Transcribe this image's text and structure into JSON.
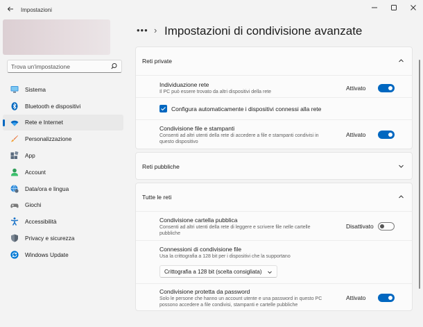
{
  "window": {
    "title": "Impostazioni",
    "minimize": "—",
    "maximize": "☐",
    "close": "✕"
  },
  "search": {
    "placeholder": "Trova un'impostazione"
  },
  "sidebar": {
    "items": [
      {
        "label": "Sistema",
        "icon": "monitor-icon",
        "color": "#0078d4"
      },
      {
        "label": "Bluetooth e dispositivi",
        "icon": "bluetooth-icon",
        "color": "#0067c0"
      },
      {
        "label": "Rete e Internet",
        "icon": "wifi-icon",
        "color": "#0067c0",
        "selected": true
      },
      {
        "label": "Personalizzazione",
        "icon": "brush-icon",
        "color": "#e8733a"
      },
      {
        "label": "App",
        "icon": "apps-icon",
        "color": "#5a6b7e"
      },
      {
        "label": "Account",
        "icon": "person-icon",
        "color": "#2f9e58"
      },
      {
        "label": "Data/ora e lingua",
        "icon": "globe-clock-icon",
        "color": "#0078d4"
      },
      {
        "label": "Giochi",
        "icon": "gamepad-icon",
        "color": "#6b6b6b"
      },
      {
        "label": "Accessibilità",
        "icon": "accessibility-icon",
        "color": "#1a73c8"
      },
      {
        "label": "Privacy e sicurezza",
        "icon": "shield-icon",
        "color": "#6b7785"
      },
      {
        "label": "Windows Update",
        "icon": "update-icon",
        "color": "#0078d4"
      }
    ]
  },
  "breadcrumb": {
    "dots": "•••",
    "chevron": "›"
  },
  "page_title": "Impostazioni di condivisione avanzate",
  "sections": {
    "private": {
      "title": "Reti private",
      "network_discovery": {
        "title": "Individuazione rete",
        "desc": "Il PC può essere trovato da altri dispositivi della rete",
        "state": "Attivato",
        "on": true
      },
      "auto_config": {
        "label": "Configura automaticamente i dispositivi connessi alla rete",
        "checked": true
      },
      "file_printer": {
        "title": "Condivisione file e stampanti",
        "desc": "Consenti ad altri utenti della rete di accedere a file e stampanti condivisi in questo dispositivo",
        "state": "Attivato",
        "on": true
      }
    },
    "public": {
      "title": "Reti pubbliche"
    },
    "all": {
      "title": "Tutte le reti",
      "public_folder": {
        "title": "Condivisione cartella pubblica",
        "desc": "Consenti ad altri utenti della rete di leggere e scrivere file nelle cartelle pubbliche",
        "state": "Disattivato",
        "on": false
      },
      "connections": {
        "title": "Connessioni di condivisione file",
        "desc": "Usa la crittografia a 128 bit per i dispositivi che la supportano",
        "selected": "Crittografia a 128 bit (scelta consigliata)"
      },
      "password": {
        "title": "Condivisione protetta da password",
        "desc": "Solo le persone che hanno un account utente e una password in questo PC possono accedere a file condivisi, stampanti e cartelle pubbliche",
        "state": "Attivato",
        "on": true
      }
    }
  },
  "colors": {
    "accent": "#0067c0",
    "background": "#f3f3f3",
    "card": "#fbfbfb"
  }
}
